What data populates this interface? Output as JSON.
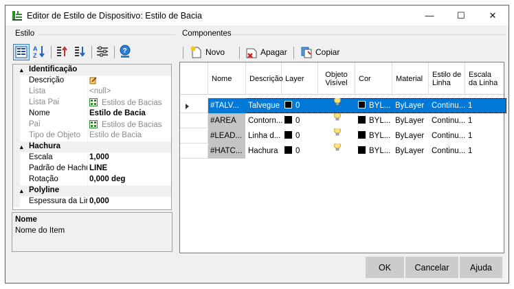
{
  "window": {
    "title": "Editor de Estilo de Dispositivo: Estilo de Bacia",
    "controls": {
      "minimize": "—",
      "maximize": "☐",
      "close": "✕"
    }
  },
  "left_panel": {
    "group_label": "Estilo",
    "toolbar_icons": [
      "categorized-view-icon",
      "sort-az-icon",
      "move-up-icon",
      "move-down-icon",
      "properties-settings-icon",
      "help-globe-icon"
    ],
    "properties": [
      {
        "type": "category",
        "label": "Identificação",
        "toggle": "▴"
      },
      {
        "type": "prop",
        "name": "Descrição",
        "value": "",
        "has_edit_icon": true
      },
      {
        "type": "prop",
        "name": "Lista",
        "value": "<null>",
        "readonly": true
      },
      {
        "type": "prop",
        "name": "Lista Pai",
        "value": "Estilos de Bacias",
        "readonly": true,
        "has_grid_icon": true
      },
      {
        "type": "prop",
        "name": "Nome",
        "value": "Estilo de Bacia",
        "bold": true
      },
      {
        "type": "prop",
        "name": "Pai",
        "value": "Estilos de Bacias",
        "readonly": true,
        "has_grid_icon": true
      },
      {
        "type": "prop",
        "name": "Tipo de Objeto",
        "value": "Estilo de Bacia",
        "readonly": true
      },
      {
        "type": "category",
        "label": "Hachura",
        "toggle": "▴"
      },
      {
        "type": "prop",
        "name": "Escala",
        "value": "1,000",
        "bold": true
      },
      {
        "type": "prop",
        "name": "Padrão de Hachu",
        "value": "LINE",
        "bold": true
      },
      {
        "type": "prop",
        "name": "Rotação",
        "value": "0,000 deg",
        "bold": true
      },
      {
        "type": "category",
        "label": "Polyline",
        "toggle": "▴"
      },
      {
        "type": "prop",
        "name": "Espessura da Lir",
        "value": "0,000",
        "bold": true
      }
    ],
    "description": {
      "title": "Nome",
      "text": "Nome do Item"
    }
  },
  "right_panel": {
    "group_label": "Componentes",
    "toolbar": {
      "new": "Novo",
      "delete": "Apagar",
      "copy": "Copiar"
    },
    "columns": [
      "Nome",
      "Descrição",
      "Layer",
      "Objeto Visível",
      "Cor",
      "Material",
      "Estilo de Linha",
      "Escala da Linha"
    ],
    "rows": [
      {
        "nome": "#TALV...",
        "descricao": "Talvegue",
        "layer": "0",
        "cor": "BYL...",
        "material": "ByLayer",
        "estilo": "Continu...",
        "escala": "1",
        "selected": true
      },
      {
        "nome": "#AREA",
        "descricao": "Contorn...",
        "layer": "0",
        "cor": "BYL...",
        "material": "ByLayer",
        "estilo": "Continu...",
        "escala": "1",
        "selected": false
      },
      {
        "nome": "#LEAD...",
        "descricao": "Linha d...",
        "layer": "0",
        "cor": "BYL...",
        "material": "ByLayer",
        "estilo": "Continu...",
        "escala": "1",
        "selected": false
      },
      {
        "nome": "#HATC...",
        "descricao": "Hachura",
        "layer": "0",
        "cor": "BYL...",
        "material": "ByLayer",
        "estilo": "Continu...",
        "escala": "1",
        "selected": false
      }
    ]
  },
  "buttons": {
    "ok": "OK",
    "cancel": "Cancelar",
    "help": "Ajuda"
  },
  "colors": {
    "selection": "#0078d7",
    "window_bg": "#f0f0f0",
    "button_bg": "#cccccc"
  }
}
